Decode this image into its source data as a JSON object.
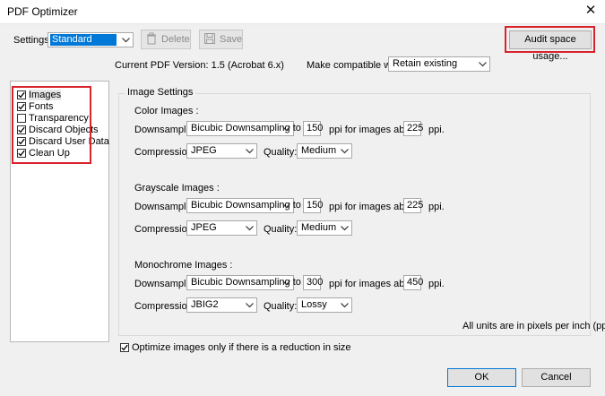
{
  "window": {
    "title": "PDF Optimizer"
  },
  "settings": {
    "label": "Settings:",
    "value": "Standard",
    "delete_label": "Delete",
    "save_label": "Save",
    "audit_label": "Audit space usage..."
  },
  "version": {
    "text": "Current PDF Version: 1.5 (Acrobat 6.x)",
    "compat_label": "Make compatible with:",
    "compat_value": "Retain existing"
  },
  "panels": [
    {
      "label": "Images",
      "checked": true,
      "selected": true
    },
    {
      "label": "Fonts",
      "checked": true
    },
    {
      "label": "Transparency",
      "checked": false
    },
    {
      "label": "Discard Objects",
      "checked": true
    },
    {
      "label": "Discard User Data",
      "checked": true
    },
    {
      "label": "Clean Up",
      "checked": true
    }
  ],
  "image_settings": {
    "title": "Image Settings",
    "labels": {
      "downsample": "Downsample:",
      "compression": "Compression:",
      "quality": "Quality:",
      "ppi_above": "ppi for images above",
      "ppi": "ppi."
    },
    "color": {
      "title": "Color Images :",
      "downsample": "Bicubic Downsampling to",
      "ppi": "150",
      "above": "225",
      "compression": "JPEG",
      "quality": "Medium"
    },
    "grayscale": {
      "title": "Grayscale Images :",
      "downsample": "Bicubic Downsampling to",
      "ppi": "150",
      "above": "225",
      "compression": "JPEG",
      "quality": "Medium"
    },
    "monochrome": {
      "title": "Monochrome Images :",
      "downsample": "Bicubic Downsampling to",
      "ppi": "300",
      "above": "450",
      "compression": "JBIG2",
      "quality": "Lossy"
    },
    "units_note": "All units are in pixels per inch (ppi)."
  },
  "optimize_only": {
    "label": "Optimize images only if there is a reduction in size",
    "checked": true
  },
  "buttons": {
    "ok": "OK",
    "cancel": "Cancel"
  },
  "colors": {
    "highlight": "#d9232d",
    "selection": "#0078d7"
  }
}
